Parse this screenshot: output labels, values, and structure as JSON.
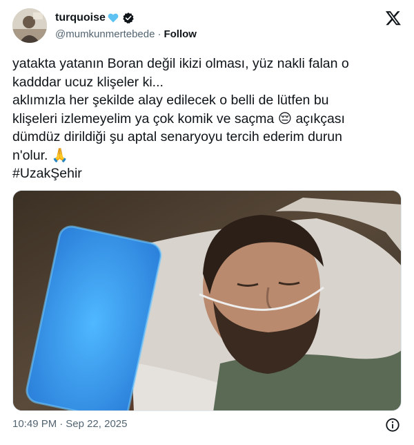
{
  "tweet": {
    "author": {
      "display_name": "turquoise",
      "handle": "@mumkunmertebede",
      "follow_label": "Follow",
      "name_emoji": "light-blue-heart",
      "verified_icon": "verified-badge-icon",
      "avatar": "profile-avatar"
    },
    "text_lines": [
      "yatakta yatanın Boran değil ikizi olması, yüz nakli falan o",
      "kadddar ucuz klişeler ki...",
      "aklımızla her şekilde alay edilecek o belli de lütfen bu",
      "klişeleri izlemeyelim ya çok komik ve saçma",
      "açıkçası",
      "dümdüz dirildiği şu aptal senaryoyu tercih ederim durun",
      "n'olur.",
      "#UzakŞehir"
    ],
    "emojis": {
      "pensive_face": "😔",
      "folded_hands": "🙏"
    },
    "media": {
      "description_icon": "video-still-man-in-hospital-bed"
    },
    "timestamp": {
      "time": "10:49 PM",
      "date": "Sep 22, 2025"
    },
    "platform_icon": "x-logo-icon",
    "info_icon": "info-icon"
  },
  "colors": {
    "text_primary": "#0f1419",
    "text_secondary": "#536471",
    "heart": "#5ec3f2",
    "verified": "#0f1419"
  }
}
